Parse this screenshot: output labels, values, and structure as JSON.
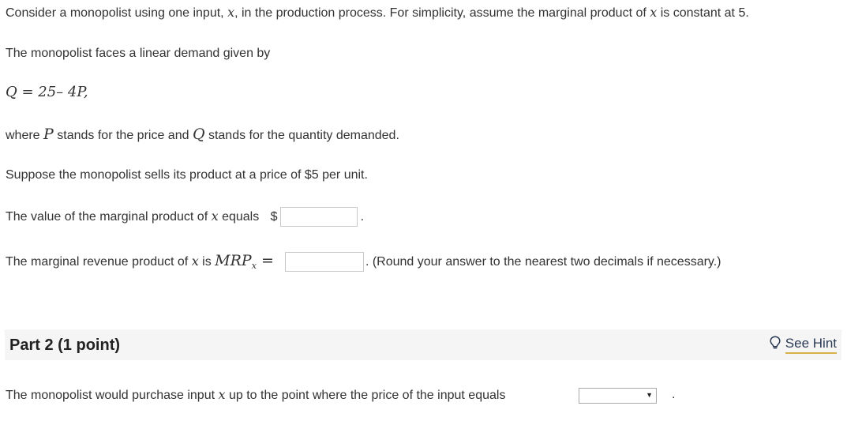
{
  "intro": {
    "text1": "Consider a monopolist using one input, ",
    "var_x": "x",
    "text2": ", in the production process. For simplicity, assume the marginal product of ",
    "text3": " is constant at 5."
  },
  "demand_intro": "The monopolist faces a linear demand given by",
  "equation": "Q = 25– 4P,",
  "where_line": {
    "t1": "where ",
    "P": "P",
    "t2": " stands for the price and ",
    "Q": "Q",
    "t3": " stands for the quantity demanded."
  },
  "price_line": "Suppose the monopolist sells its product at a price of $5 per unit.",
  "vmp_line": {
    "t1": "The value of the marginal product of ",
    "t2": " equals",
    "currency": "$",
    "value": "",
    "end": "."
  },
  "mrp_line": {
    "t1": "The marginal revenue product of ",
    "t2": " is ",
    "mrp": "MRP",
    "sub": "x",
    "eq": " = ",
    "value": "",
    "end": ". (Round your answer to the nearest two decimals if necessary.)"
  },
  "part2": {
    "title": "Part 2   (1 point)",
    "hint_label": "See Hint",
    "hint_icon": "lightbulb-icon",
    "question_t1": "The monopolist would purchase input ",
    "question_t2": " up to the point where the price of the input equals",
    "select_value": "",
    "end": "."
  }
}
